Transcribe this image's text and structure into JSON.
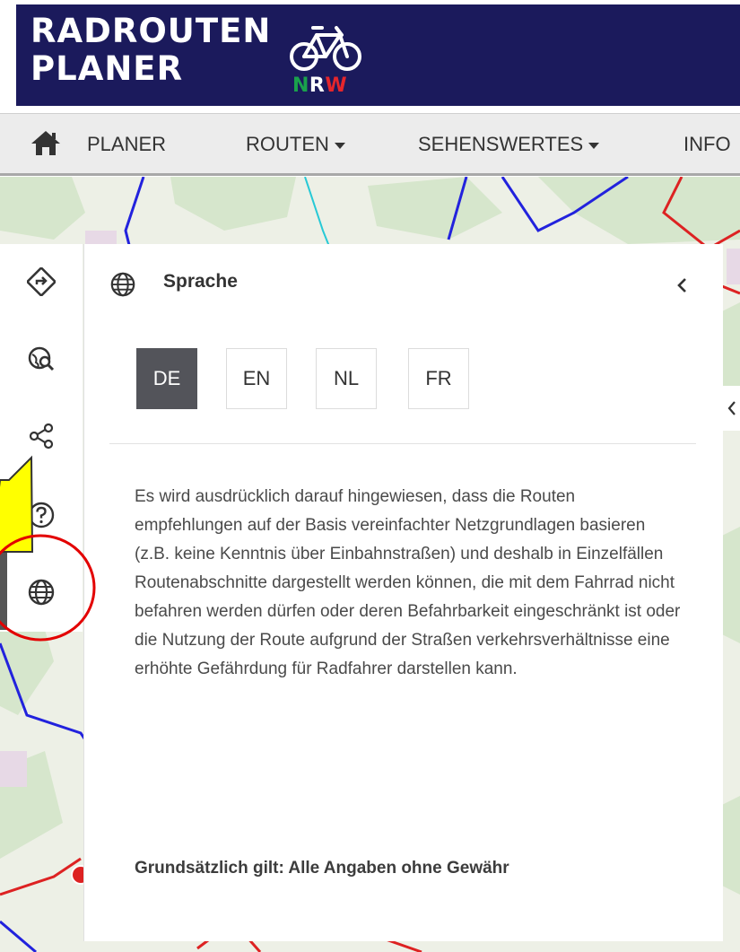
{
  "brand": {
    "line1": "RADROUTEN",
    "line2": "PLANER",
    "nrw": {
      "n": "N",
      "r": "R",
      "w": "W"
    },
    "colors": {
      "header_bg": "#1b1a5c",
      "nrw_green": "#1aa14c",
      "nrw_red": "#e4262c"
    }
  },
  "nav": {
    "home_icon": "home-icon",
    "items": [
      {
        "label": "PLANER",
        "has_caret": false
      },
      {
        "label": "ROUTEN",
        "has_caret": true
      },
      {
        "label": "SEHENSWERTES",
        "has_caret": true
      },
      {
        "label": "INFO",
        "has_caret": false
      }
    ]
  },
  "sidebar": {
    "buttons": [
      {
        "icon": "route-directions-icon"
      },
      {
        "icon": "globe-search-icon"
      },
      {
        "icon": "share-icon"
      },
      {
        "icon": "help-icon"
      },
      {
        "icon": "globe-icon",
        "active": true
      }
    ]
  },
  "panel": {
    "title": "Sprache",
    "title_icon": "globe-icon",
    "close_icon": "chevron-left-icon",
    "languages": [
      {
        "code": "DE",
        "selected": true
      },
      {
        "code": "EN",
        "selected": false
      },
      {
        "code": "NL",
        "selected": false
      },
      {
        "code": "FR",
        "selected": false
      }
    ],
    "info_text": "Es wird ausdrücklich darauf hingewiesen, dass die Routen empfehlungen auf der Basis vereinfachter Netzgrundlagen basieren (z.B. keine Kenntnis über Einbahnstraßen) und deshalb in Einzelfällen Routenabschnitte dargestellt werden können, die mit dem Fahrrad nicht befahren werden dürfen oder deren Befahrbarkeit eingeschränkt ist oder die Nutzung der Route aufgrund der Straßen verkehrsverhältnisse eine erhöhte Gefährdung für Radfahrer darstellen kann.",
    "info_strong": "Grundsätzlich gilt: Alle Angaben ohne Gewähr",
    "colors": {
      "selected_bg": "#53545a"
    }
  },
  "annotation": {
    "arrow_color": "#ffff00",
    "circle_color": "#e30000"
  }
}
